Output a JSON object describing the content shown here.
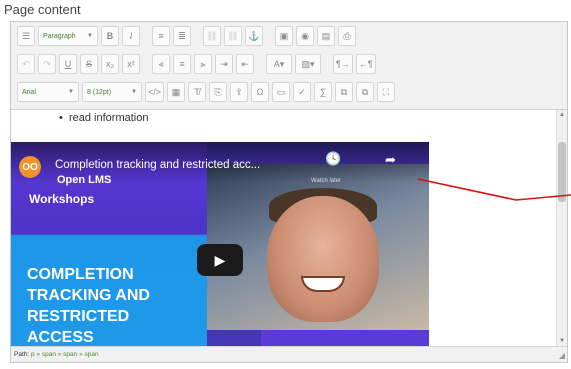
{
  "page": {
    "label": "Page content"
  },
  "toolbar": {
    "row1": {
      "paragraph_select": "Paragraph"
    },
    "row3": {
      "font_family": "Arial",
      "font_size": "8 (12pt)"
    }
  },
  "content": {
    "bullet": "read information"
  },
  "video": {
    "logo": "OO",
    "title": "Completion tracking and restricted acc...",
    "watch_later": "Watch later",
    "brand": "Open LMS",
    "workshops": "Workshops",
    "big_line1": "COMPLETION",
    "big_line2": "TRACKING AND",
    "big_line3": "RESTRICTED",
    "big_line4": "ACCESS",
    "play_icon": "play-icon"
  },
  "statusbar": {
    "path_label": "Path:",
    "path_value": "p » span » span » span"
  },
  "colors": {
    "annotation_arrow": "#dd1111"
  }
}
